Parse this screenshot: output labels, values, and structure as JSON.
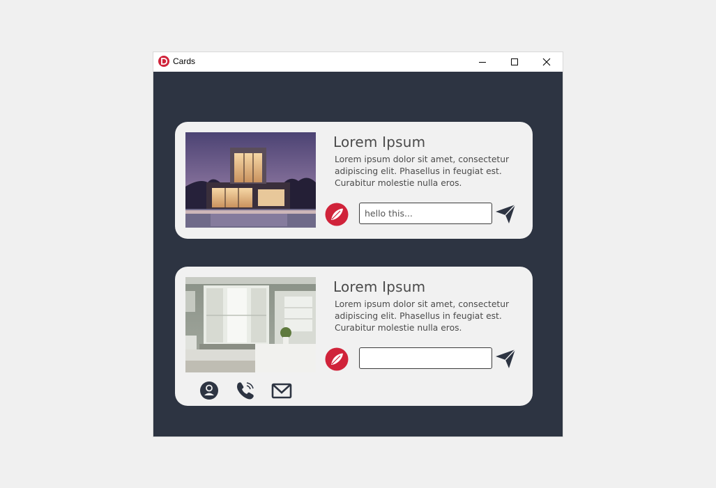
{
  "window": {
    "title": "Cards",
    "controls": [
      "minimize",
      "maximize",
      "close"
    ]
  },
  "colors": {
    "background": "#2d3442",
    "card": "#f1f1f1",
    "accent": "#d0233a",
    "text": "#4a4a4a",
    "icon": "#2d3442"
  },
  "cards": [
    {
      "image": "modern-house-at-dusk",
      "title": "Lorem Ipsum",
      "body": "Lorem ipsum dolor sit amet, consectetur adipiscing elit. Phasellus in feugiat est. Curabitur molestie nulla eros.",
      "input_value": "hello this...",
      "icons": [
        "feather-logo-icon",
        "send-icon"
      ]
    },
    {
      "image": "bright-kitchen-interior",
      "title": "Lorem Ipsum",
      "body": "Lorem ipsum dolor sit amet, consectetur adipiscing elit. Phasellus in feugiat est. Curabitur molestie nulla eros.",
      "input_value": "",
      "icons": [
        "feather-logo-icon",
        "send-icon"
      ],
      "social_icons": [
        "user-icon",
        "phone-icon",
        "mail-icon"
      ]
    }
  ]
}
